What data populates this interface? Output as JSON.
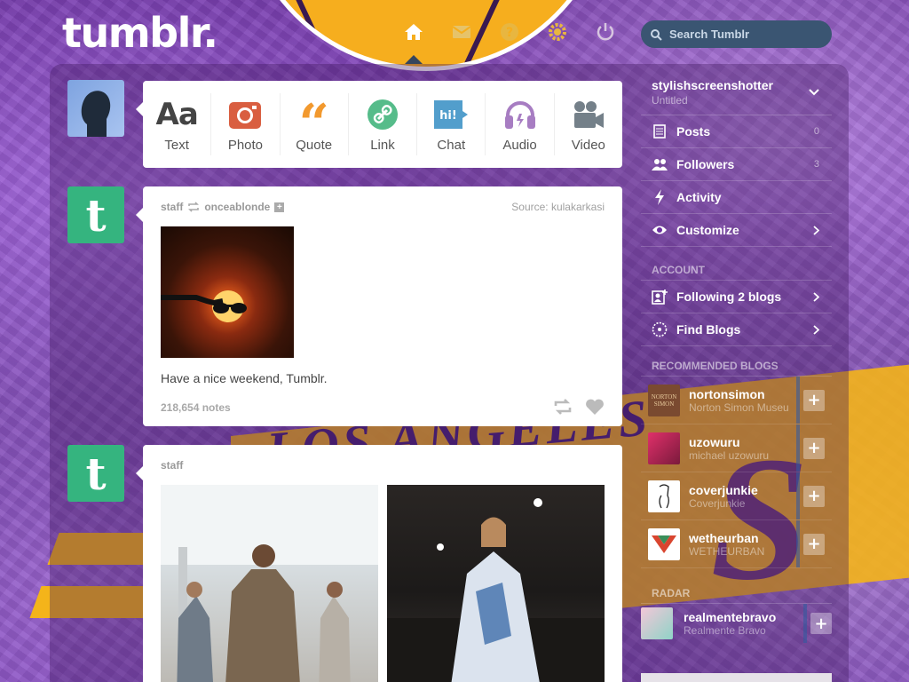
{
  "header": {
    "logo": "tumblr.",
    "search_placeholder": "Search Tumblr",
    "nav": [
      {
        "name": "home-icon",
        "active": true
      },
      {
        "name": "mail-icon"
      },
      {
        "name": "help-icon"
      },
      {
        "name": "gear-icon"
      },
      {
        "name": "power-icon"
      }
    ]
  },
  "composer": {
    "types": [
      {
        "label": "Text",
        "icon": "text-icon",
        "color": "#444444"
      },
      {
        "label": "Photo",
        "icon": "camera-icon",
        "color": "#d95e40"
      },
      {
        "label": "Quote",
        "icon": "quote-icon",
        "color": "#f2992e"
      },
      {
        "label": "Link",
        "icon": "link-icon",
        "color": "#56bc8a"
      },
      {
        "label": "Chat",
        "icon": "chat-icon",
        "color": "#529ecc"
      },
      {
        "label": "Audio",
        "icon": "headphones-icon",
        "color": "#a77dc2"
      },
      {
        "label": "Video",
        "icon": "video-camera-icon",
        "color": "#748089"
      }
    ]
  },
  "posts": [
    {
      "author": "staff",
      "reblogged_from": "onceablonde",
      "source_label": "Source:",
      "source": "kulakarkasi",
      "caption": "Have a nice weekend, Tumblr.",
      "notes": "218,654 notes"
    },
    {
      "author": "staff"
    }
  ],
  "sidebar": {
    "blog_name": "stylishscreenshotter",
    "blog_title": "Untitled",
    "items": [
      {
        "label": "Posts",
        "count": "0",
        "icon": "posts-icon"
      },
      {
        "label": "Followers",
        "count": "3",
        "icon": "followers-icon"
      },
      {
        "label": "Activity",
        "icon": "bolt-icon"
      },
      {
        "label": "Customize",
        "icon": "eye-icon"
      }
    ],
    "account_header": "ACCOUNT",
    "account_items": [
      {
        "label": "Following 2 blogs",
        "icon": "add-person-icon"
      },
      {
        "label": "Find Blogs",
        "icon": "compass-icon"
      }
    ],
    "recommended_header": "RECOMMENDED BLOGS",
    "recommended": [
      {
        "name": "nortonsimon",
        "desc": "Norton Simon Museu",
        "thumb_color": "#7a4a30"
      },
      {
        "name": "uzowuru",
        "desc": "michael uzowuru",
        "thumb_color": "#d4527a"
      },
      {
        "name": "coverjunkie",
        "desc": "Coverjunkie",
        "thumb_color": "#ffffff"
      },
      {
        "name": "wetheurban",
        "desc": "WETHEURBAN",
        "thumb_color": "#ffffff"
      }
    ],
    "radar_header": "RADAR",
    "radar": {
      "name": "realmentebravo",
      "desc": "Realmente Bravo"
    }
  }
}
